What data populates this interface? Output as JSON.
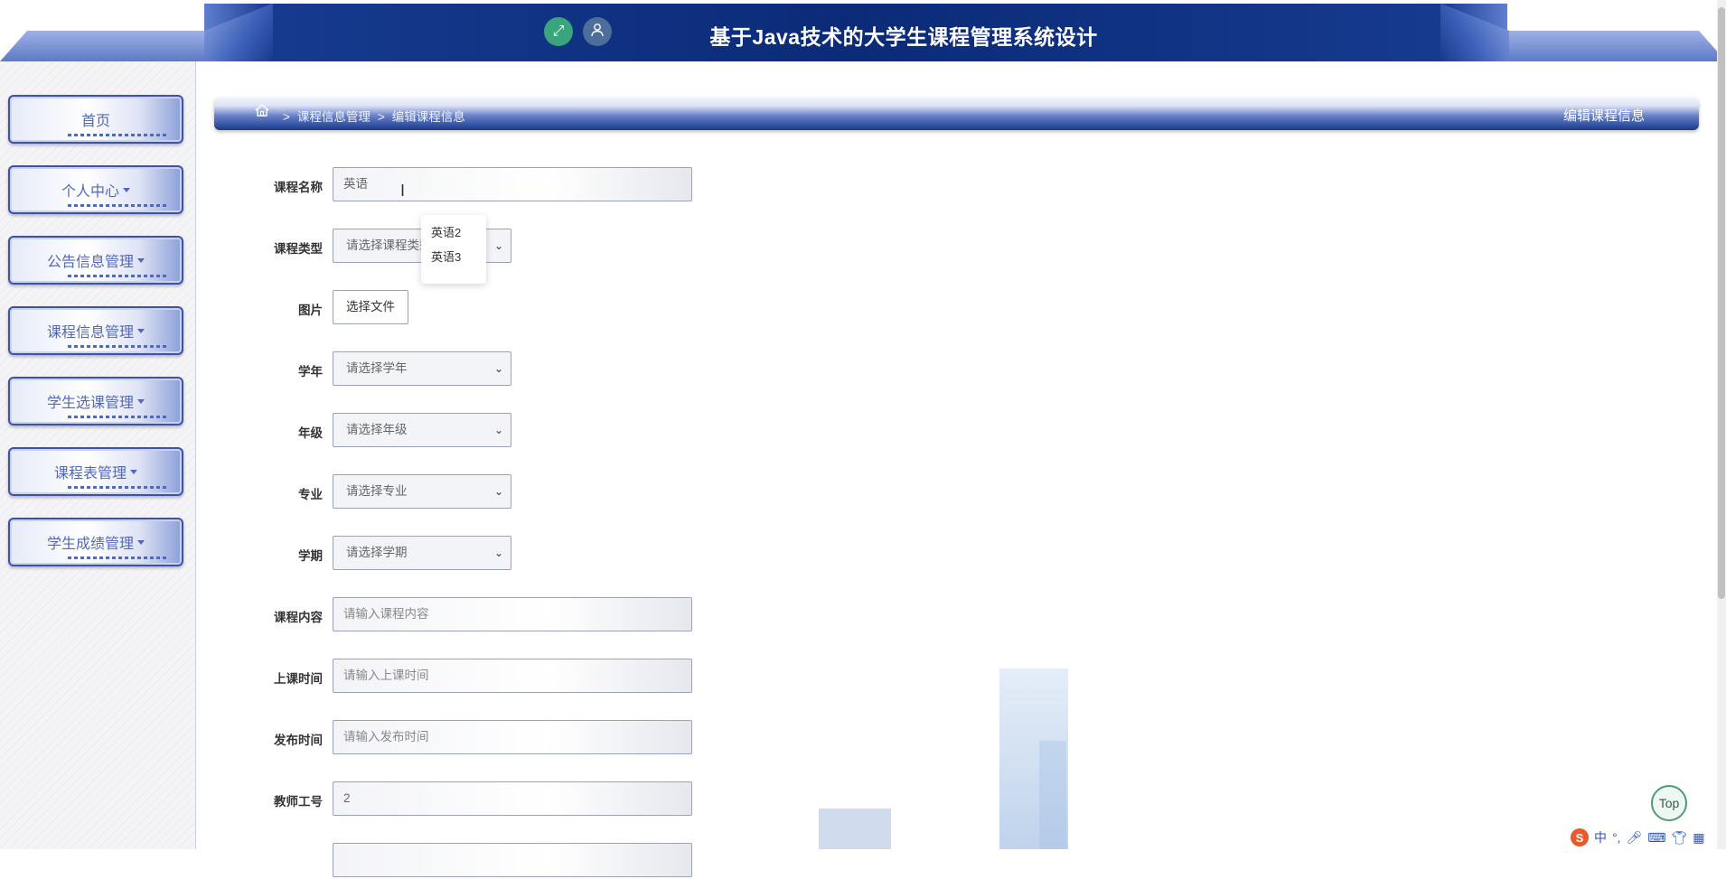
{
  "header": {
    "title": "基于Java技术的大学生课程管理系统设计",
    "expand_icon": "expand-icon",
    "user_icon": "user-icon"
  },
  "sidebar": {
    "items": [
      {
        "label": "首页",
        "has_caret": false
      },
      {
        "label": "个人中心",
        "has_caret": true
      },
      {
        "label": "公告信息管理",
        "has_caret": true
      },
      {
        "label": "课程信息管理",
        "has_caret": true
      },
      {
        "label": "学生选课管理",
        "has_caret": true
      },
      {
        "label": "课程表管理",
        "has_caret": true
      },
      {
        "label": "学生成绩管理",
        "has_caret": true
      }
    ]
  },
  "breadcrumb": {
    "separator": ">",
    "level1": "课程信息管理",
    "level2": "编辑课程信息",
    "right_title": "编辑课程信息"
  },
  "form": {
    "course_name": {
      "label": "课程名称",
      "value": "英语"
    },
    "course_type": {
      "label": "课程类型",
      "placeholder": "请选择课程类型"
    },
    "image": {
      "label": "图片",
      "button": "选择文件"
    },
    "school_year": {
      "label": "学年",
      "placeholder": "请选择学年"
    },
    "grade": {
      "label": "年级",
      "placeholder": "请选择年级"
    },
    "major": {
      "label": "专业",
      "placeholder": "请选择专业"
    },
    "semester": {
      "label": "学期",
      "placeholder": "请选择学期"
    },
    "content": {
      "label": "课程内容",
      "placeholder": "请输入课程内容"
    },
    "class_time": {
      "label": "上课时间",
      "placeholder": "请输入上课时间"
    },
    "publish_time": {
      "label": "发布时间",
      "placeholder": "请输入发布时间"
    },
    "teacher_id": {
      "label": "教师工号",
      "value": "2"
    }
  },
  "autocomplete": [
    "英语2",
    "英语3"
  ],
  "top_button": "Top",
  "ime": {
    "logo": "S",
    "mode": "中"
  }
}
